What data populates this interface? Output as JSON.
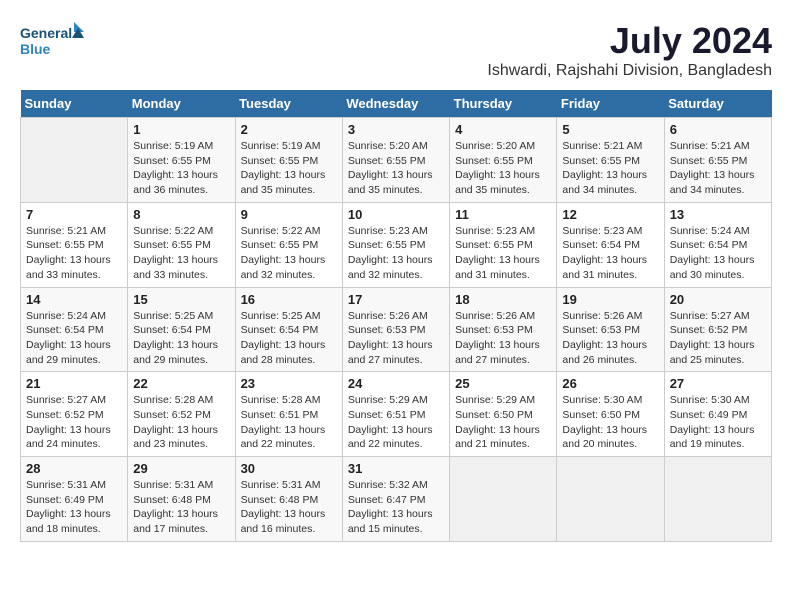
{
  "header": {
    "logo_line1": "General",
    "logo_line2": "Blue",
    "month_title": "July 2024",
    "location": "Ishwardi, Rajshahi Division, Bangladesh"
  },
  "days_of_week": [
    "Sunday",
    "Monday",
    "Tuesday",
    "Wednesday",
    "Thursday",
    "Friday",
    "Saturday"
  ],
  "weeks": [
    [
      {
        "num": "",
        "info": ""
      },
      {
        "num": "1",
        "info": "Sunrise: 5:19 AM\nSunset: 6:55 PM\nDaylight: 13 hours\nand 36 minutes."
      },
      {
        "num": "2",
        "info": "Sunrise: 5:19 AM\nSunset: 6:55 PM\nDaylight: 13 hours\nand 35 minutes."
      },
      {
        "num": "3",
        "info": "Sunrise: 5:20 AM\nSunset: 6:55 PM\nDaylight: 13 hours\nand 35 minutes."
      },
      {
        "num": "4",
        "info": "Sunrise: 5:20 AM\nSunset: 6:55 PM\nDaylight: 13 hours\nand 35 minutes."
      },
      {
        "num": "5",
        "info": "Sunrise: 5:21 AM\nSunset: 6:55 PM\nDaylight: 13 hours\nand 34 minutes."
      },
      {
        "num": "6",
        "info": "Sunrise: 5:21 AM\nSunset: 6:55 PM\nDaylight: 13 hours\nand 34 minutes."
      }
    ],
    [
      {
        "num": "7",
        "info": "Sunrise: 5:21 AM\nSunset: 6:55 PM\nDaylight: 13 hours\nand 33 minutes."
      },
      {
        "num": "8",
        "info": "Sunrise: 5:22 AM\nSunset: 6:55 PM\nDaylight: 13 hours\nand 33 minutes."
      },
      {
        "num": "9",
        "info": "Sunrise: 5:22 AM\nSunset: 6:55 PM\nDaylight: 13 hours\nand 32 minutes."
      },
      {
        "num": "10",
        "info": "Sunrise: 5:23 AM\nSunset: 6:55 PM\nDaylight: 13 hours\nand 32 minutes."
      },
      {
        "num": "11",
        "info": "Sunrise: 5:23 AM\nSunset: 6:55 PM\nDaylight: 13 hours\nand 31 minutes."
      },
      {
        "num": "12",
        "info": "Sunrise: 5:23 AM\nSunset: 6:54 PM\nDaylight: 13 hours\nand 31 minutes."
      },
      {
        "num": "13",
        "info": "Sunrise: 5:24 AM\nSunset: 6:54 PM\nDaylight: 13 hours\nand 30 minutes."
      }
    ],
    [
      {
        "num": "14",
        "info": "Sunrise: 5:24 AM\nSunset: 6:54 PM\nDaylight: 13 hours\nand 29 minutes."
      },
      {
        "num": "15",
        "info": "Sunrise: 5:25 AM\nSunset: 6:54 PM\nDaylight: 13 hours\nand 29 minutes."
      },
      {
        "num": "16",
        "info": "Sunrise: 5:25 AM\nSunset: 6:54 PM\nDaylight: 13 hours\nand 28 minutes."
      },
      {
        "num": "17",
        "info": "Sunrise: 5:26 AM\nSunset: 6:53 PM\nDaylight: 13 hours\nand 27 minutes."
      },
      {
        "num": "18",
        "info": "Sunrise: 5:26 AM\nSunset: 6:53 PM\nDaylight: 13 hours\nand 27 minutes."
      },
      {
        "num": "19",
        "info": "Sunrise: 5:26 AM\nSunset: 6:53 PM\nDaylight: 13 hours\nand 26 minutes."
      },
      {
        "num": "20",
        "info": "Sunrise: 5:27 AM\nSunset: 6:52 PM\nDaylight: 13 hours\nand 25 minutes."
      }
    ],
    [
      {
        "num": "21",
        "info": "Sunrise: 5:27 AM\nSunset: 6:52 PM\nDaylight: 13 hours\nand 24 minutes."
      },
      {
        "num": "22",
        "info": "Sunrise: 5:28 AM\nSunset: 6:52 PM\nDaylight: 13 hours\nand 23 minutes."
      },
      {
        "num": "23",
        "info": "Sunrise: 5:28 AM\nSunset: 6:51 PM\nDaylight: 13 hours\nand 22 minutes."
      },
      {
        "num": "24",
        "info": "Sunrise: 5:29 AM\nSunset: 6:51 PM\nDaylight: 13 hours\nand 22 minutes."
      },
      {
        "num": "25",
        "info": "Sunrise: 5:29 AM\nSunset: 6:50 PM\nDaylight: 13 hours\nand 21 minutes."
      },
      {
        "num": "26",
        "info": "Sunrise: 5:30 AM\nSunset: 6:50 PM\nDaylight: 13 hours\nand 20 minutes."
      },
      {
        "num": "27",
        "info": "Sunrise: 5:30 AM\nSunset: 6:49 PM\nDaylight: 13 hours\nand 19 minutes."
      }
    ],
    [
      {
        "num": "28",
        "info": "Sunrise: 5:31 AM\nSunset: 6:49 PM\nDaylight: 13 hours\nand 18 minutes."
      },
      {
        "num": "29",
        "info": "Sunrise: 5:31 AM\nSunset: 6:48 PM\nDaylight: 13 hours\nand 17 minutes."
      },
      {
        "num": "30",
        "info": "Sunrise: 5:31 AM\nSunset: 6:48 PM\nDaylight: 13 hours\nand 16 minutes."
      },
      {
        "num": "31",
        "info": "Sunrise: 5:32 AM\nSunset: 6:47 PM\nDaylight: 13 hours\nand 15 minutes."
      },
      {
        "num": "",
        "info": ""
      },
      {
        "num": "",
        "info": ""
      },
      {
        "num": "",
        "info": ""
      }
    ]
  ]
}
